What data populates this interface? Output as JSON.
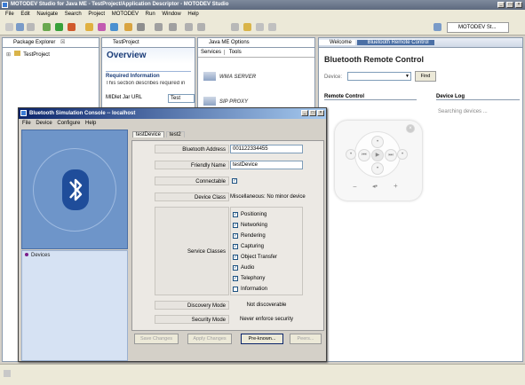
{
  "window": {
    "title": "MOTODEV Studio for Java ME - TestProject/Application Descriptor - MOTODEV Studio"
  },
  "menu": [
    "File",
    "Edit",
    "Navigate",
    "Search",
    "Project",
    "MOTODEV",
    "Run",
    "Window",
    "Help"
  ],
  "perspective": {
    "label": "MOTODEV St..."
  },
  "package_explorer": {
    "tab": "Package Explorer",
    "tab_close": "☒",
    "items": [
      {
        "label": "TestProject",
        "expander": "⊞"
      }
    ]
  },
  "test_project": {
    "tab": "TestProject",
    "overview_title": "Overview",
    "section_title": "Required Information",
    "section_text": "This section describes required in",
    "jar_url_label": "MIDlet Jar URL",
    "jar_url_value": "Test"
  },
  "me_options": {
    "tab": "Java ME Options",
    "subtabs": [
      "Services",
      "Tools"
    ],
    "items": [
      "WMA SERVER",
      "SIP PROXY"
    ]
  },
  "right_tabs": [
    "Welcome",
    "Bluetooth Remote Control"
  ],
  "bluetooth": {
    "title": "Bluetooth Remote Control",
    "device_label": "Device:",
    "find_label": "Find",
    "remote_control_label": "Remote Control",
    "device_log_label": "Device Log",
    "log_text": "Searching devices ..."
  },
  "remote_symbols": {
    "bl": "−",
    "bm": "◂•",
    "br": "+",
    "mid_l": "⏮",
    "mid_r": "⏭",
    "play": "▶",
    "close": "×"
  },
  "console": {
    "title": "Bluetooth Simulation Console -- localhost",
    "title_buttons": [
      "_",
      "□",
      "×"
    ],
    "menu": [
      "File",
      "Device",
      "Configure",
      "Help"
    ],
    "devices_label": "Devices",
    "tabs": [
      "testDevice",
      "test2"
    ],
    "fields": {
      "address_label": "Bluetooth Address",
      "address_value": "001122334455",
      "name_label": "Friendly Name",
      "name_value": "testDevice",
      "connectable_label": "Connectable",
      "class_label": "Device Class",
      "class_value": "Miscellaneous: No minor device",
      "service_label": "Service Classes",
      "discovery_label": "Discovery Mode",
      "discovery_value": "Not discoverable",
      "security_label": "Security Mode",
      "security_value": "Never enforce security"
    },
    "services": [
      {
        "label": "Positioning",
        "checked": true
      },
      {
        "label": "Networking",
        "checked": true
      },
      {
        "label": "Rendering",
        "checked": true
      },
      {
        "label": "Capturing",
        "checked": true
      },
      {
        "label": "Object Transfer",
        "checked": true
      },
      {
        "label": "Audio",
        "checked": true
      },
      {
        "label": "Telephony",
        "checked": true
      },
      {
        "label": "Information",
        "checked": false
      }
    ],
    "buttons": {
      "save": "Save Changes",
      "apply": "Apply Changes",
      "preknown": "Pre-known...",
      "peers": "Peers..."
    }
  },
  "colors": {
    "accent": "#0a246a",
    "panel_blue": "#6e95c9",
    "bt_blue": "#1f4d9a"
  }
}
